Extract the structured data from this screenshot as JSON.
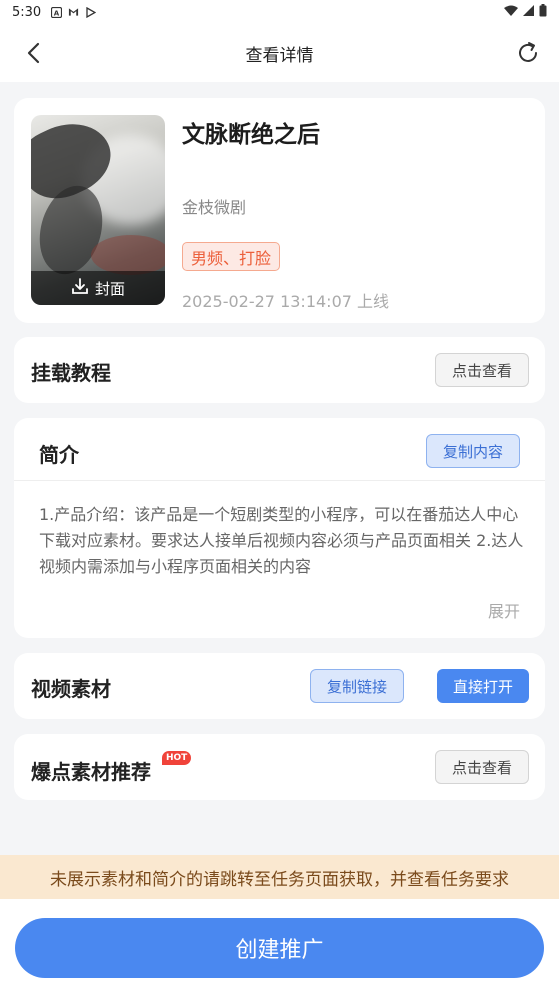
{
  "status_bar": {
    "time": "5:30",
    "left_icons": [
      "a-icon",
      "gmail-icon",
      "play-icon"
    ],
    "right_icons": [
      "wifi-icon",
      "signal-icon",
      "battery-icon"
    ]
  },
  "nav": {
    "title": "查看详情"
  },
  "drama": {
    "title": "文脉断绝之后",
    "producer": "金枝微剧",
    "tags": "男频、打脸",
    "online_time": "2025-02-27 13:14:07 上线",
    "cover_download_label": "封面"
  },
  "tutorial": {
    "title": "挂载教程",
    "button_label": "点击查看"
  },
  "intro": {
    "title": "简介",
    "copy_label": "复制内容",
    "text": "1.产品介绍：该产品是一个短剧类型的小程序，可以在番茄达人中心下载对应素材。要求达人接单后视频内容必须与产品页面相关 2.达人视频内需添加与小程序页面相关的内容",
    "expand_label": "展开"
  },
  "video": {
    "title": "视频素材",
    "copy_link_label": "复制链接",
    "open_label": "直接打开"
  },
  "hot": {
    "title": "爆点素材推荐",
    "badge": "HOT",
    "button_label": "点击查看"
  },
  "notice": "未展示素材和简介的请跳转至任务页面获取，并查看任务要求",
  "create_button_label": "创建推广",
  "colors": {
    "primary_blue": "#4a88f0",
    "tag_red": "#ec5f3a",
    "notice_bg": "#fae8d0",
    "hot_red": "#f0433a"
  }
}
